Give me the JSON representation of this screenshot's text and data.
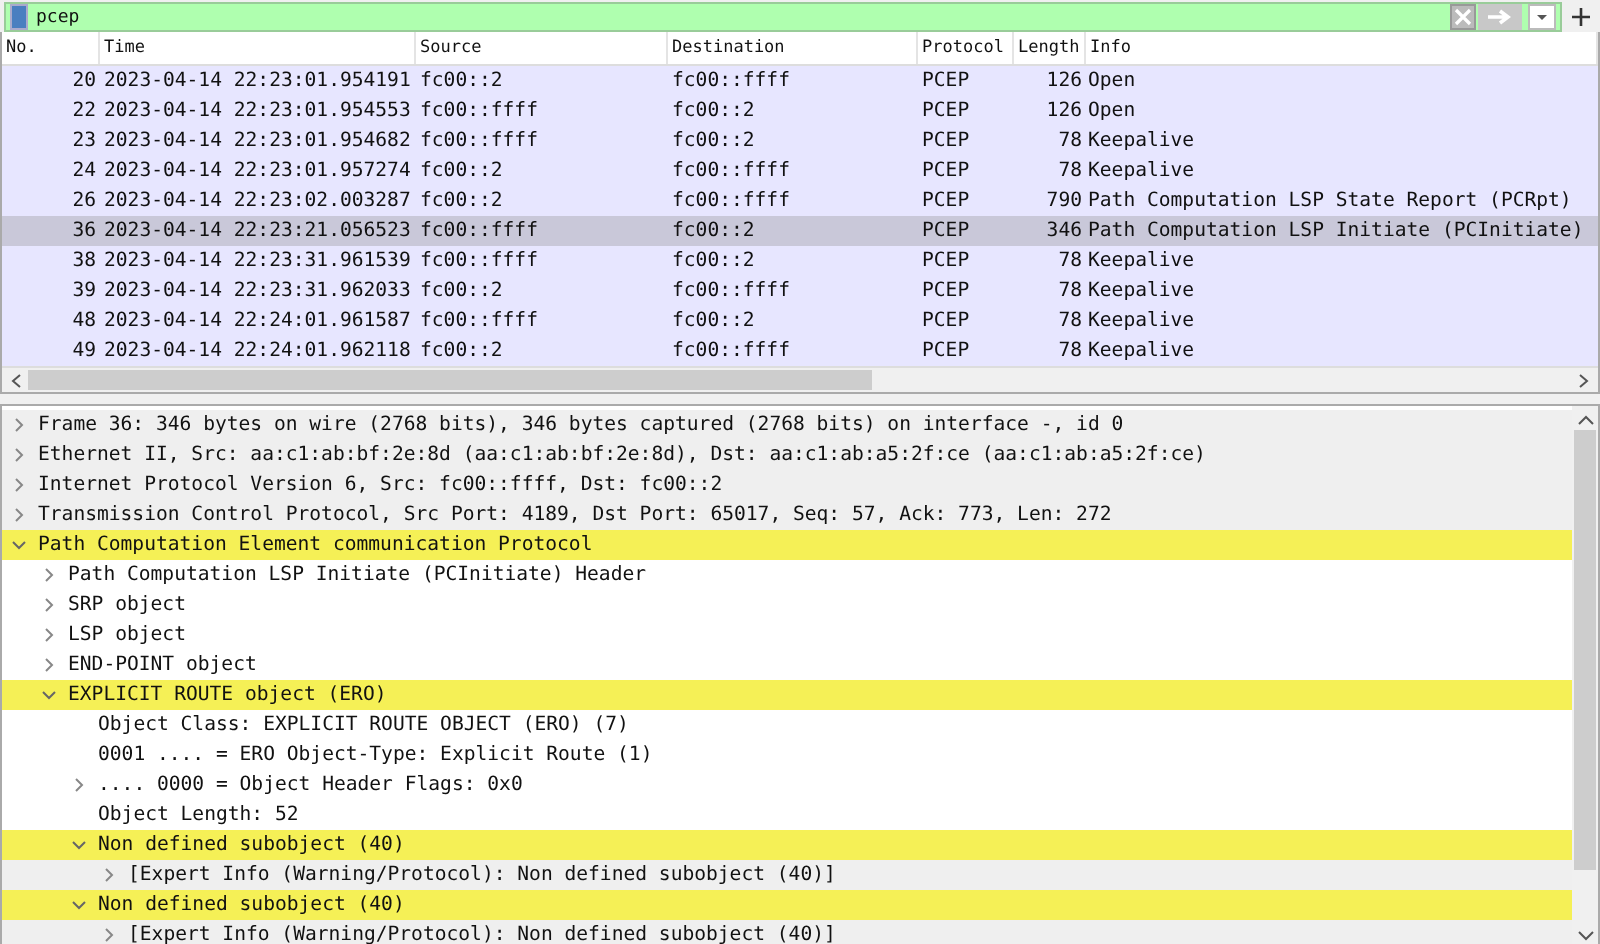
{
  "filter": {
    "value": "pcep"
  },
  "packet_list": {
    "columns": [
      "No.",
      "Time",
      "Source",
      "Destination",
      "Protocol",
      "Length",
      "Info"
    ],
    "rows": [
      {
        "no": "20",
        "time": "2023-04-14 22:23:01.954191",
        "source": "fc00::2",
        "destination": "fc00::ffff",
        "protocol": "PCEP",
        "length": "126",
        "info": "Open",
        "selected": false
      },
      {
        "no": "22",
        "time": "2023-04-14 22:23:01.954553",
        "source": "fc00::ffff",
        "destination": "fc00::2",
        "protocol": "PCEP",
        "length": "126",
        "info": "Open",
        "selected": false
      },
      {
        "no": "23",
        "time": "2023-04-14 22:23:01.954682",
        "source": "fc00::ffff",
        "destination": "fc00::2",
        "protocol": "PCEP",
        "length": "78",
        "info": "Keepalive",
        "selected": false
      },
      {
        "no": "24",
        "time": "2023-04-14 22:23:01.957274",
        "source": "fc00::2",
        "destination": "fc00::ffff",
        "protocol": "PCEP",
        "length": "78",
        "info": "Keepalive",
        "selected": false
      },
      {
        "no": "26",
        "time": "2023-04-14 22:23:02.003287",
        "source": "fc00::2",
        "destination": "fc00::ffff",
        "protocol": "PCEP",
        "length": "790",
        "info": "Path Computation LSP State Report (PCRpt)",
        "selected": false
      },
      {
        "no": "36",
        "time": "2023-04-14 22:23:21.056523",
        "source": "fc00::ffff",
        "destination": "fc00::2",
        "protocol": "PCEP",
        "length": "346",
        "info": "Path Computation LSP Initiate (PCInitiate)",
        "selected": true
      },
      {
        "no": "38",
        "time": "2023-04-14 22:23:31.961539",
        "source": "fc00::ffff",
        "destination": "fc00::2",
        "protocol": "PCEP",
        "length": "78",
        "info": "Keepalive",
        "selected": false
      },
      {
        "no": "39",
        "time": "2023-04-14 22:23:31.962033",
        "source": "fc00::2",
        "destination": "fc00::ffff",
        "protocol": "PCEP",
        "length": "78",
        "info": "Keepalive",
        "selected": false
      },
      {
        "no": "48",
        "time": "2023-04-14 22:24:01.961587",
        "source": "fc00::ffff",
        "destination": "fc00::2",
        "protocol": "PCEP",
        "length": "78",
        "info": "Keepalive",
        "selected": false
      },
      {
        "no": "49",
        "time": "2023-04-14 22:24:01.962118",
        "source": "fc00::2",
        "destination": "fc00::ffff",
        "protocol": "PCEP",
        "length": "78",
        "info": "Keepalive",
        "selected": false
      }
    ]
  },
  "details": [
    {
      "text": "Frame 36: 346 bytes on wire (2768 bits), 346 bytes captured (2768 bits) on interface -, id 0",
      "kind": "shaded",
      "expanded": false
    },
    {
      "text": "Ethernet II, Src: aa:c1:ab:bf:2e:8d (aa:c1:ab:bf:2e:8d), Dst: aa:c1:ab:a5:2f:ce (aa:c1:ab:a5:2f:ce)",
      "kind": "shaded",
      "expanded": false
    },
    {
      "text": "Internet Protocol Version 6, Src: fc00::ffff, Dst: fc00::2",
      "kind": "shaded",
      "expanded": false
    },
    {
      "text": "Transmission Control Protocol, Src Port: 4189, Dst Port: 65017, Seq: 57, Ack: 773, Len: 272",
      "kind": "shaded",
      "expanded": false
    },
    {
      "text": "Path Computation Element communication Protocol",
      "kind": "warning",
      "expanded": true,
      "children": [
        {
          "text": "Path Computation LSP Initiate (PCInitiate) Header",
          "kind": "plain",
          "expanded": false
        },
        {
          "text": "SRP object",
          "kind": "plain",
          "expanded": false
        },
        {
          "text": "LSP object",
          "kind": "plain",
          "expanded": false
        },
        {
          "text": "END-POINT object",
          "kind": "plain",
          "expanded": false
        },
        {
          "text": "EXPLICIT ROUTE object (ERO)",
          "kind": "warning",
          "expanded": true,
          "children": [
            {
              "text": "Object Class: EXPLICIT ROUTE OBJECT (ERO) (7)",
              "kind": "plain"
            },
            {
              "text": "0001 .... = ERO Object-Type: Explicit Route (1)",
              "kind": "plain"
            },
            {
              "text": ".... 0000 = Object Header Flags: 0x0",
              "kind": "plain",
              "expanded": false
            },
            {
              "text": "Object Length: 52",
              "kind": "plain"
            },
            {
              "text": "Non defined subobject (40)",
              "kind": "warning",
              "expanded": true,
              "children": [
                {
                  "text": "[Expert Info (Warning/Protocol): Non defined subobject (40)]",
                  "kind": "shaded",
                  "expanded": false
                }
              ]
            },
            {
              "text": "Non defined subobject (40)",
              "kind": "warning",
              "expanded": true,
              "children": [
                {
                  "text": "[Expert Info (Warning/Protocol): Non defined subobject (40)]",
                  "kind": "shaded",
                  "expanded": false
                }
              ]
            }
          ]
        }
      ]
    }
  ]
}
